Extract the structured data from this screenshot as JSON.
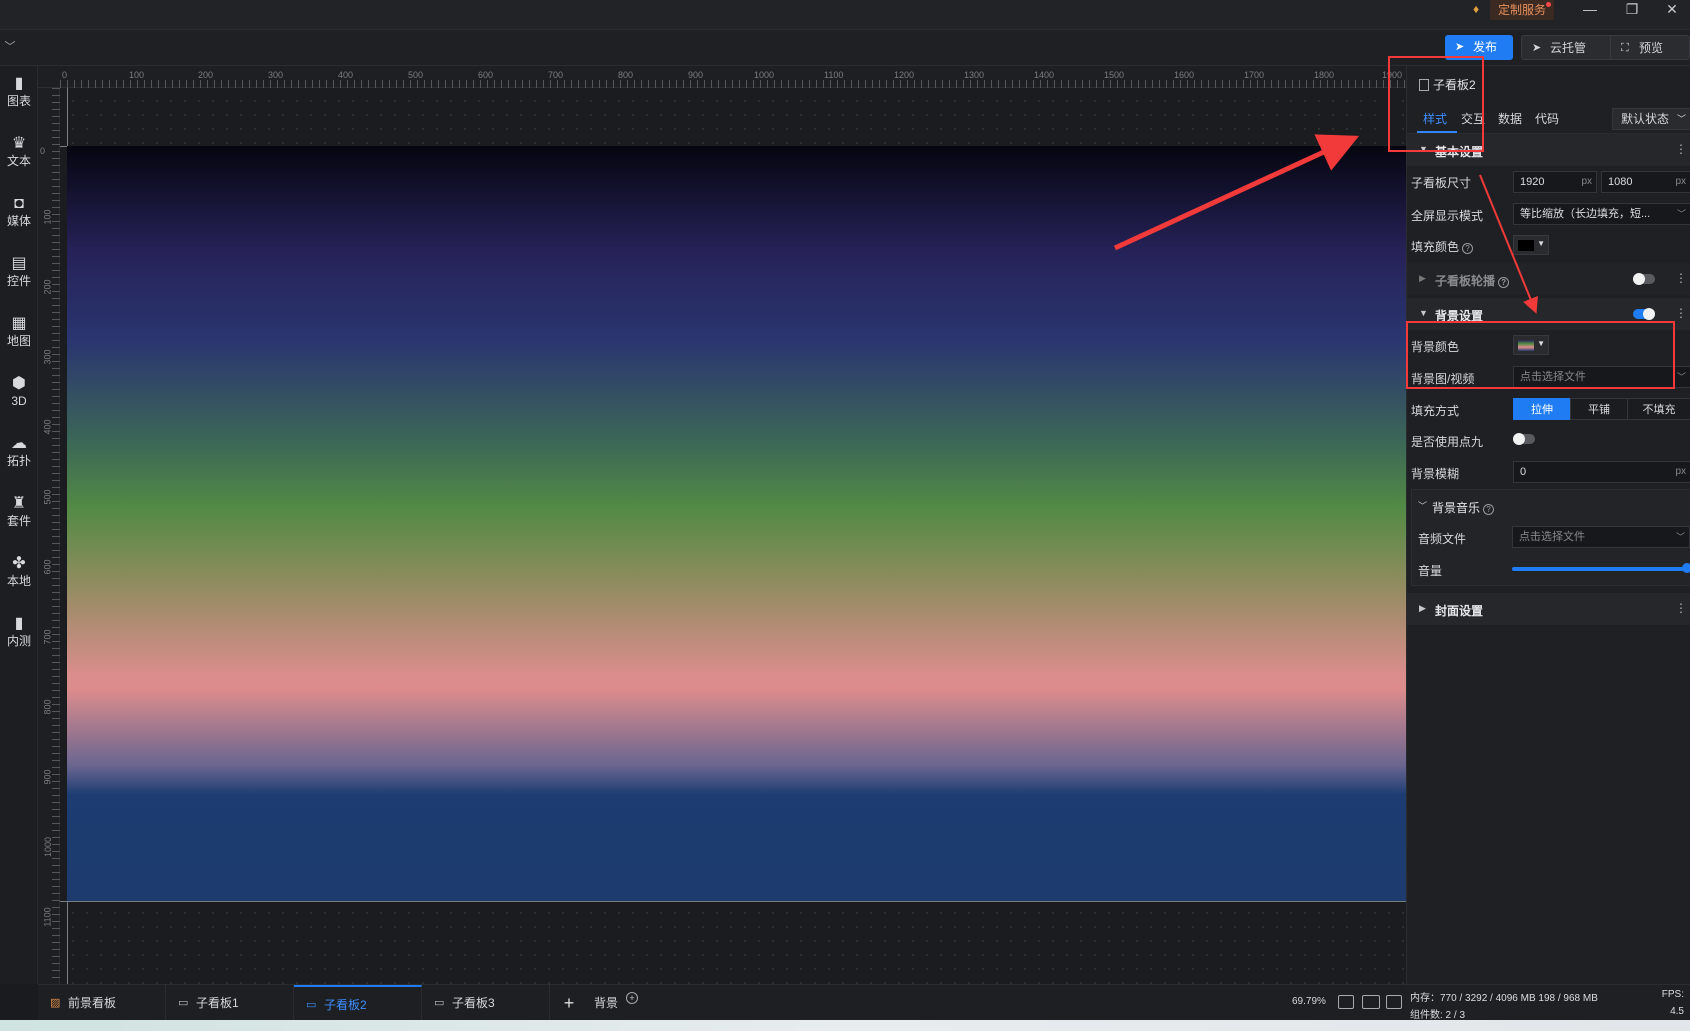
{
  "titlebar": {
    "vip_icon": "diamond-icon",
    "custom_service": "定制服务",
    "minimize": "—",
    "restore": "❐",
    "close": "✕"
  },
  "toolbar": {
    "publish_label": "发布",
    "cloud_label": "云托管",
    "preview_label": "预览",
    "accent": "#1f7cf2"
  },
  "sidebar": {
    "items": [
      {
        "label": "图表",
        "icon": "chart-icon"
      },
      {
        "label": "文本",
        "icon": "text-icon"
      },
      {
        "label": "媒体",
        "icon": "media-icon"
      },
      {
        "label": "控件",
        "icon": "widget-icon"
      },
      {
        "label": "地图",
        "icon": "map-icon"
      },
      {
        "label": "3D",
        "icon": "cube-icon"
      },
      {
        "label": "拓扑",
        "icon": "topology-icon"
      },
      {
        "label": "套件",
        "icon": "kit-icon"
      },
      {
        "label": "本地",
        "icon": "local-icon"
      },
      {
        "label": "内测",
        "icon": "beta-icon"
      }
    ]
  },
  "ruler": {
    "top_ticks": [
      "0",
      "100",
      "200",
      "300",
      "400",
      "500",
      "600",
      "700",
      "800",
      "900",
      "1000",
      "1100",
      "1200",
      "1300",
      "1400",
      "1500",
      "1600",
      "1700",
      "1800",
      "1900"
    ],
    "left_ticks": [
      "0",
      "100",
      "200",
      "300",
      "400",
      "500",
      "600",
      "700",
      "800",
      "900",
      "1000",
      "1100"
    ]
  },
  "panel": {
    "title": "子看板2",
    "tabs": [
      "样式",
      "交互",
      "数据",
      "代码"
    ],
    "state_select": "默认状态",
    "basic": {
      "title": "基本设置",
      "size_label": "子看板尺寸",
      "width": "1920",
      "height": "1080",
      "unit": "px",
      "fullscreen_label": "全屏显示模式",
      "fullscreen_value": "等比缩放（长边填充，短...",
      "fill_color_label": "填充颜色",
      "fill_color": "#000000"
    },
    "carousel": {
      "title": "子看板轮播"
    },
    "background": {
      "title": "背景设置",
      "color_label": "背景颜色",
      "image_label": "背景图/视频",
      "image_placeholder": "点击选择文件",
      "fill_mode_label": "填充方式",
      "fill_modes": [
        "拉伸",
        "平铺",
        "不填充"
      ],
      "nine_label": "是否使用点九",
      "blur_label": "背景模糊",
      "blur_value": "0",
      "blur_unit": "px"
    },
    "music": {
      "title": "背景音乐",
      "file_label": "音频文件",
      "file_placeholder": "点击选择文件",
      "volume_label": "音量"
    },
    "cover": {
      "title": "封面设置"
    }
  },
  "bottom": {
    "tabs": [
      {
        "label": "前景看板",
        "icon": "foreground-icon"
      },
      {
        "label": "子看板1",
        "icon": "board-icon"
      },
      {
        "label": "子看板2",
        "icon": "board-icon"
      },
      {
        "label": "子看板3",
        "icon": "board-icon"
      }
    ],
    "add": "+",
    "background_tab": "背景",
    "zoom": "69.79%"
  },
  "status": {
    "memory": "内存：770 / 3292 / 4096 MB  198 / 968 MB",
    "fps": "FPS:",
    "components": "组件数: 2 / 3",
    "fps_value": "4.5"
  }
}
